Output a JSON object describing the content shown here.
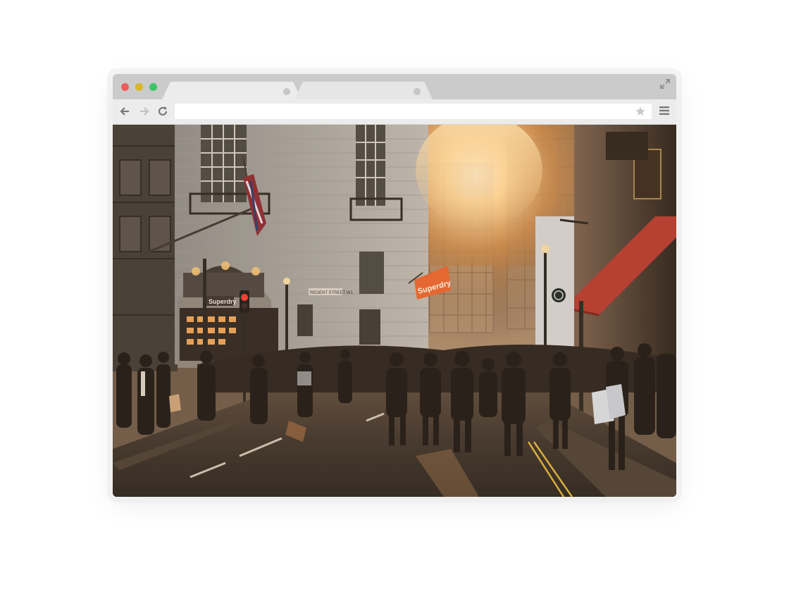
{
  "browser": {
    "window_controls": [
      "close",
      "minimize",
      "maximize"
    ],
    "colors": {
      "close": "#ee5b5b",
      "minimize": "#d9b52a",
      "maximize": "#3dc56a"
    },
    "tabs": [
      {
        "label": "",
        "active": true
      },
      {
        "label": "",
        "active": false
      }
    ],
    "address_bar": {
      "value": ""
    },
    "icons": [
      "back-arrow-icon",
      "forward-arrow-icon",
      "reload-icon",
      "star-icon",
      "menu-icon",
      "expand-icon"
    ]
  },
  "page": {
    "hero_image": {
      "description_icon": "photo",
      "signs": {
        "shop_banner": "Superdry",
        "shop_facade": "Superdry",
        "street_plaque": "REGENT STREET W1"
      }
    }
  }
}
